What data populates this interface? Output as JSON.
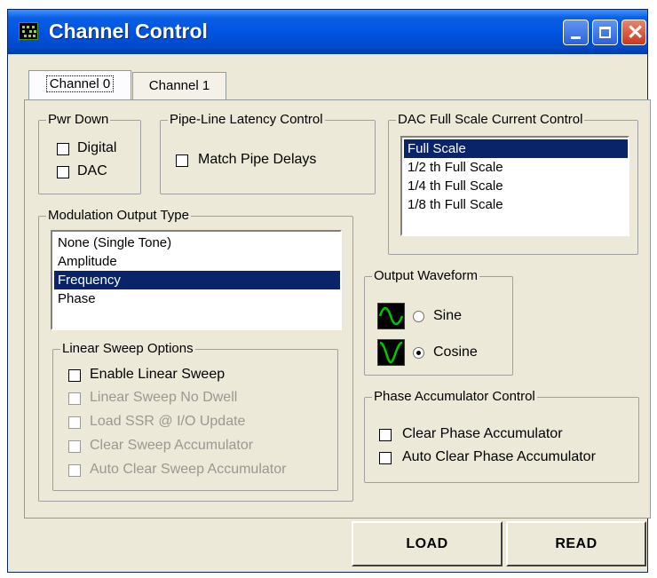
{
  "window": {
    "title": "Channel Control"
  },
  "tabs": [
    {
      "label": "Channel 0",
      "selected": true
    },
    {
      "label": "Channel 1",
      "selected": false
    }
  ],
  "pwr_down": {
    "title": "Pwr Down",
    "options": [
      {
        "label": "Digital",
        "checked": false
      },
      {
        "label": "DAC",
        "checked": false
      }
    ]
  },
  "pipeline": {
    "title": "Pipe-Line Latency Control",
    "option": {
      "label": "Match Pipe Delays",
      "checked": false
    }
  },
  "dac": {
    "title": "DAC Full Scale Current Control",
    "items": [
      "Full Scale",
      "1/2 th Full Scale",
      "1/4 th Full Scale",
      "1/8 th Full Scale"
    ],
    "selected": "Full Scale"
  },
  "modulation": {
    "title": "Modulation Output Type",
    "items": [
      "None (Single Tone)",
      "Amplitude",
      "Frequency",
      "Phase"
    ],
    "selected": "Frequency"
  },
  "linear_sweep": {
    "title": "Linear Sweep Options",
    "options": [
      {
        "label": "Enable Linear Sweep",
        "checked": false,
        "enabled": true
      },
      {
        "label": "Linear Sweep No Dwell",
        "checked": false,
        "enabled": false
      },
      {
        "label": "Load SSR @ I/O Update",
        "checked": false,
        "enabled": false
      },
      {
        "label": "Clear Sweep Accumulator",
        "checked": false,
        "enabled": false
      },
      {
        "label": "Auto Clear Sweep Accumulator",
        "checked": false,
        "enabled": false
      }
    ]
  },
  "waveform": {
    "title": "Output Waveform",
    "options": [
      {
        "label": "Sine",
        "selected": false,
        "icon": "sine-wave-icon"
      },
      {
        "label": "Cosine",
        "selected": true,
        "icon": "cosine-wave-icon"
      }
    ],
    "wave_color": "#00c800"
  },
  "phase_acc": {
    "title": "Phase Accumulator Control",
    "options": [
      {
        "label": "Clear Phase Accumulator",
        "checked": false
      },
      {
        "label": "Auto Clear Phase Accumulator",
        "checked": false
      }
    ]
  },
  "buttons": {
    "load": "LOAD",
    "read": "READ"
  },
  "colors": {
    "selection": "#0a246a",
    "titlebar": "#0054e3",
    "face": "#ece9d8",
    "disabled_text": "#9a9891"
  }
}
